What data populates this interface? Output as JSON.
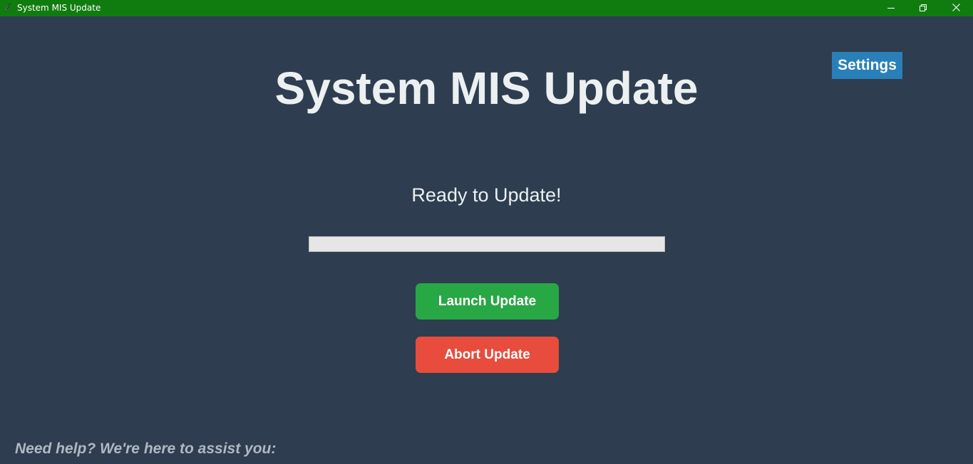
{
  "window": {
    "title": "System MIS Update",
    "app_icon": "feather-icon",
    "controls": {
      "minimize": "minimize-icon",
      "maximize": "restore-icon",
      "close": "close-icon"
    },
    "titlebar_color": "#107c10"
  },
  "header": {
    "title": "System MIS Update",
    "settings_label": "Settings"
  },
  "status": {
    "text": "Ready to Update!",
    "progress": 0
  },
  "actions": {
    "launch_label": "Launch Update",
    "abort_label": "Abort Update"
  },
  "footer": {
    "help_text": "Need help? We're here to assist you:"
  },
  "colors": {
    "background": "#2e3d50",
    "text": "#ecf0f1",
    "settings": "#2980b9",
    "launch": "#28a745",
    "abort": "#e74c3c"
  }
}
